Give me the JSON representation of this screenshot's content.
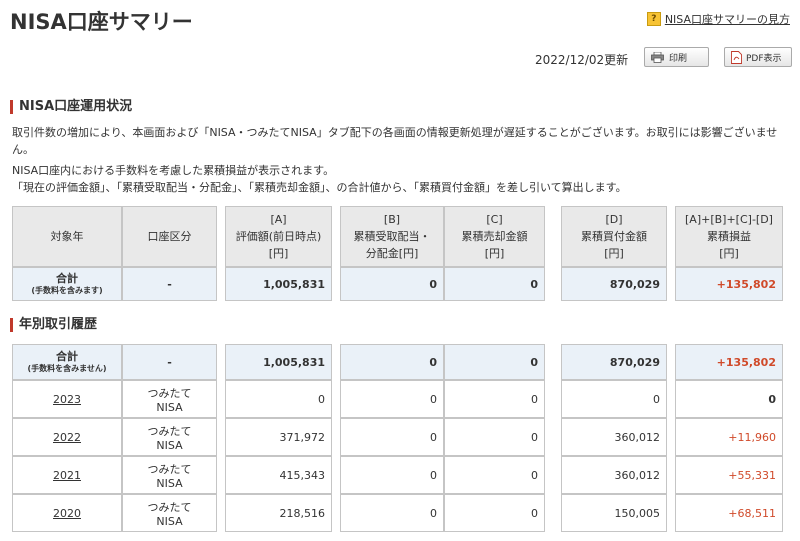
{
  "header": {
    "title": "NISA口座サマリー",
    "help_link": "NISA口座サマリーの見方",
    "help_icon": "?",
    "updated": "2022/12/02更新",
    "print_label": "印刷",
    "pdf_label": "PDF表示"
  },
  "section1": {
    "title": "NISA口座運用状況",
    "desc1": "取引件数の増加により、本画面および「NISA・つみたてNISA」タブ配下の各画面の情報更新処理が遅延することがございます。お取引には影響ございません。",
    "desc2": "NISA口座内における手数料を考慮した累積損益が表示されます。",
    "desc3": "「現在の評価金額」、「累積受取配当・分配金」、「累積売却金額」、の合計値から、「累積買付金額」を差し引いて算出します。",
    "headers": {
      "year": "対象年",
      "type": "口座区分",
      "a_code": "[A]",
      "a_name": "評価額(前日時点)",
      "a_unit": "[円]",
      "b_code": "[B]",
      "b_name1": "累積受取配当・",
      "b_name2": "分配金[円]",
      "c_code": "[C]",
      "c_name": "累積売却金額",
      "c_unit": "[円]",
      "d_code": "[D]",
      "d_name": "累積買付金額",
      "d_unit": "[円]",
      "e_code": "[A]+[B]+[C]-[D]",
      "e_name": "累積損益",
      "e_unit": "[円]"
    },
    "total": {
      "label": "合計",
      "note": "(手数料を含みます)",
      "type": "-",
      "a": "1,005,831",
      "b": "0",
      "c": "0",
      "d": "870,029",
      "e": "+135,802"
    }
  },
  "section2": {
    "title": "年別取引履歴",
    "total": {
      "label": "合計",
      "note": "(手数料を含みません)",
      "type": "-",
      "a": "1,005,831",
      "b": "0",
      "c": "0",
      "d": "870,029",
      "e": "+135,802"
    },
    "rows": [
      {
        "year": "2023",
        "type1": "つみたて",
        "type2": "NISA",
        "a": "0",
        "b": "0",
        "c": "0",
        "d": "0",
        "e": "0"
      },
      {
        "year": "2022",
        "type1": "つみたて",
        "type2": "NISA",
        "a": "371,972",
        "b": "0",
        "c": "0",
        "d": "360,012",
        "e": "+11,960"
      },
      {
        "year": "2021",
        "type1": "つみたて",
        "type2": "NISA",
        "a": "415,343",
        "b": "0",
        "c": "0",
        "d": "360,012",
        "e": "+55,331"
      },
      {
        "year": "2020",
        "type1": "つみたて",
        "type2": "NISA",
        "a": "218,516",
        "b": "0",
        "c": "0",
        "d": "150,005",
        "e": "+68,511"
      }
    ]
  },
  "colors": {
    "accent": "#c0392b",
    "profit": "#d04a2a",
    "header_bg": "#e9e9e9",
    "total_bg": "#eaf1f8"
  }
}
